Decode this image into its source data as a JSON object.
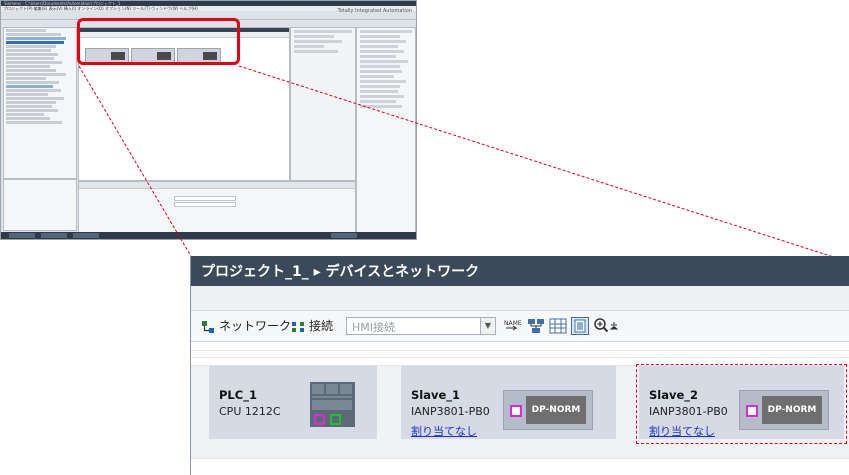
{
  "thumbnail": {
    "window_title": "Siemens - C:\\Users\\Documents\\Automation\\プロジェクト_1",
    "menu": "プロジェクト(P)  編集(E)  表示(V)  挿入(I)  オンライン(O)  オプション(N)  ツール(T)  ウィンドウ(W)  ヘルプ(H)",
    "brand": "Totally Integrated Automation"
  },
  "editor": {
    "breadcrumb": "プロジェクト_1_  ▸  デバイスとネットワーク",
    "toolbar": {
      "network_label": "ネットワーク",
      "connection_label": "接続",
      "connection_combo_value": "HMI接続"
    }
  },
  "devices": [
    {
      "name": "PLC_1",
      "type": "CPU 1212C"
    },
    {
      "name": "Slave_1",
      "type": "IANP3801-PB0",
      "link": "割り当てなし",
      "module_label": "DP-NORM"
    },
    {
      "name": "Slave_2",
      "type": "IANP3801-PB0",
      "link": "割り当てなし",
      "module_label": "DP-NORM"
    }
  ],
  "colors": {
    "highlight": "#e60012",
    "title_bar": "#3b4a5a",
    "device_bg": "#d5dae4",
    "port_magenta": "#d62fd0",
    "port_green": "#1fbf2f",
    "link_blue": "#1a33cc"
  }
}
